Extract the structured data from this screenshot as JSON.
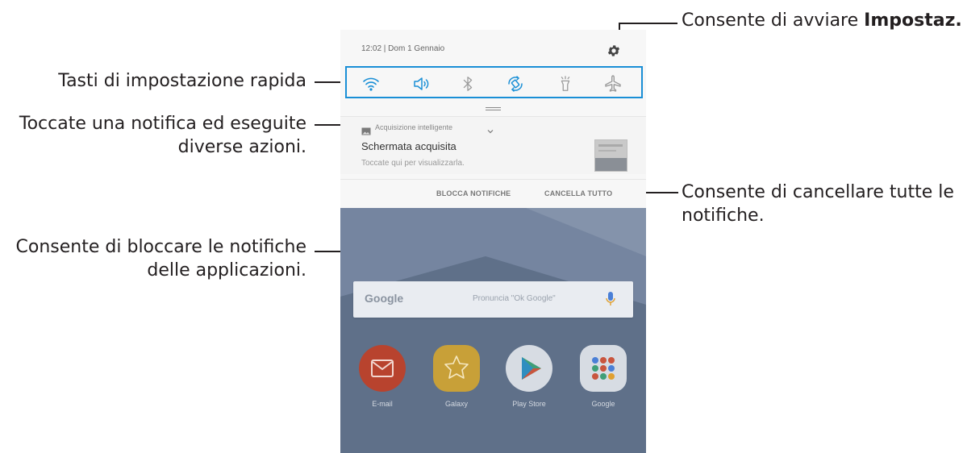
{
  "callouts": {
    "settings": {
      "prefix": "Consente di avviare ",
      "bold": "Impostaz."
    },
    "quick_settings": "Tasti di impostazione rapida",
    "notification": {
      "line1": "Toccate una notifica ed eseguite",
      "line2": "diverse azioni."
    },
    "clear_all": {
      "line1": "Consente di cancellare tutte le",
      "line2": "notifiche."
    },
    "block": {
      "line1": "Consente di bloccare le notifiche",
      "line2": "delle applicazioni."
    }
  },
  "phone": {
    "status_bar": {
      "text": "12:02 | Dom 1 Gennaio"
    },
    "quick_settings": [
      "wifi-icon",
      "sound-icon",
      "bluetooth-icon",
      "auto-rotate-icon",
      "flashlight-icon",
      "airplane-icon"
    ],
    "notification": {
      "app_name": "Acquisizione intelligente",
      "title": "Schermata acquisita",
      "subtitle": "Toccate qui per visualizzarla."
    },
    "actions": {
      "block": "BLOCCA NOTIFICHE",
      "clear": "CANCELLA TUTTO"
    },
    "home": {
      "search": {
        "brand": "Google",
        "hint": "Pronuncia \"Ok Google\""
      },
      "apps": [
        "E-mail",
        "Galaxy",
        "Play Store",
        "Google"
      ]
    }
  },
  "colors": {
    "accent": "#1a8fd6",
    "text": "#231f20",
    "home_bg": "#66778f"
  }
}
